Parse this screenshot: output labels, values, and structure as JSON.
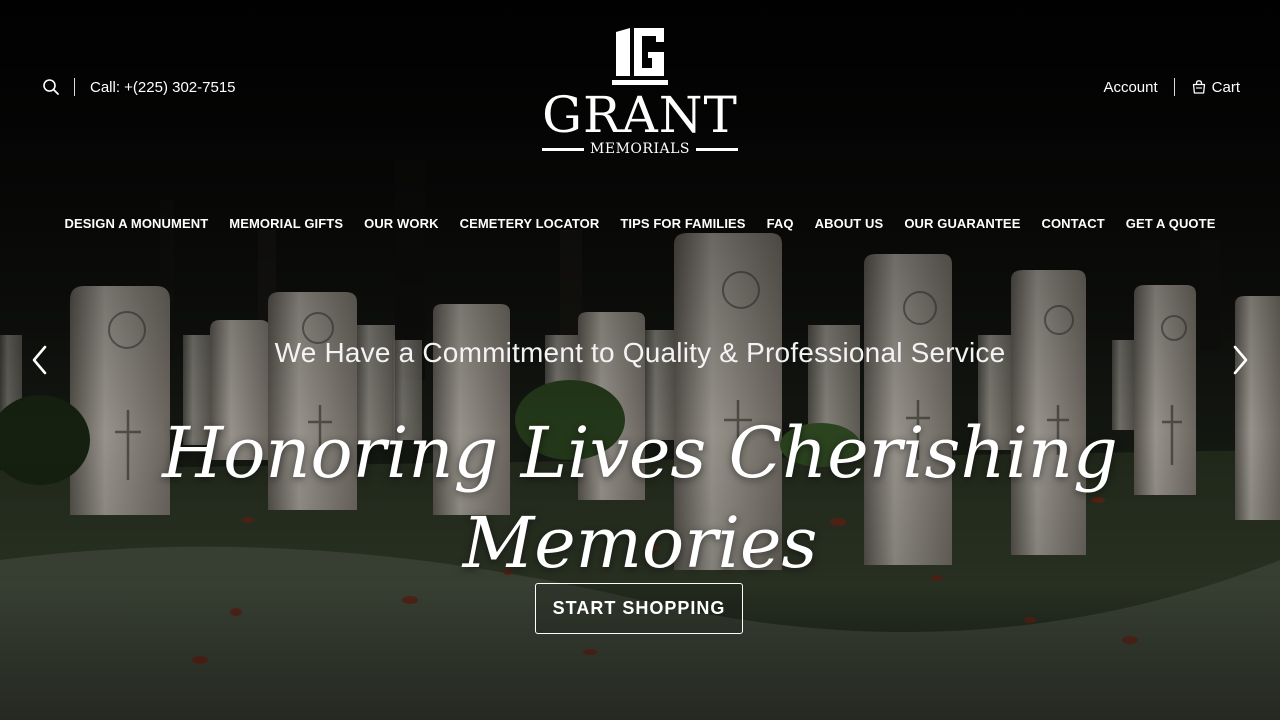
{
  "header": {
    "phone_label": "Call: +(225) 302-7515",
    "account_label": "Account",
    "cart_label": "Cart"
  },
  "logo": {
    "name": "GRANT",
    "subtitle": "MEMORIALS"
  },
  "nav": {
    "items": [
      "DESIGN A MONUMENT",
      "MEMORIAL GIFTS",
      "OUR WORK",
      "CEMETERY LOCATOR",
      "TIPS FOR FAMILIES",
      "FAQ",
      "ABOUT US",
      "OUR GUARANTEE",
      "CONTACT",
      "GET A QUOTE"
    ]
  },
  "hero": {
    "tagline": "We Have a Commitment to Quality & Professional Service",
    "headline": "Honoring Lives Cherishing Memories",
    "cta_label": "START SHOPPING"
  },
  "icons": {
    "search": "search-icon",
    "cart": "cart-icon",
    "prev": "chevron-left-icon",
    "next": "chevron-right-icon"
  },
  "colors": {
    "text": "#ffffff",
    "background": "#0a0a0a"
  }
}
